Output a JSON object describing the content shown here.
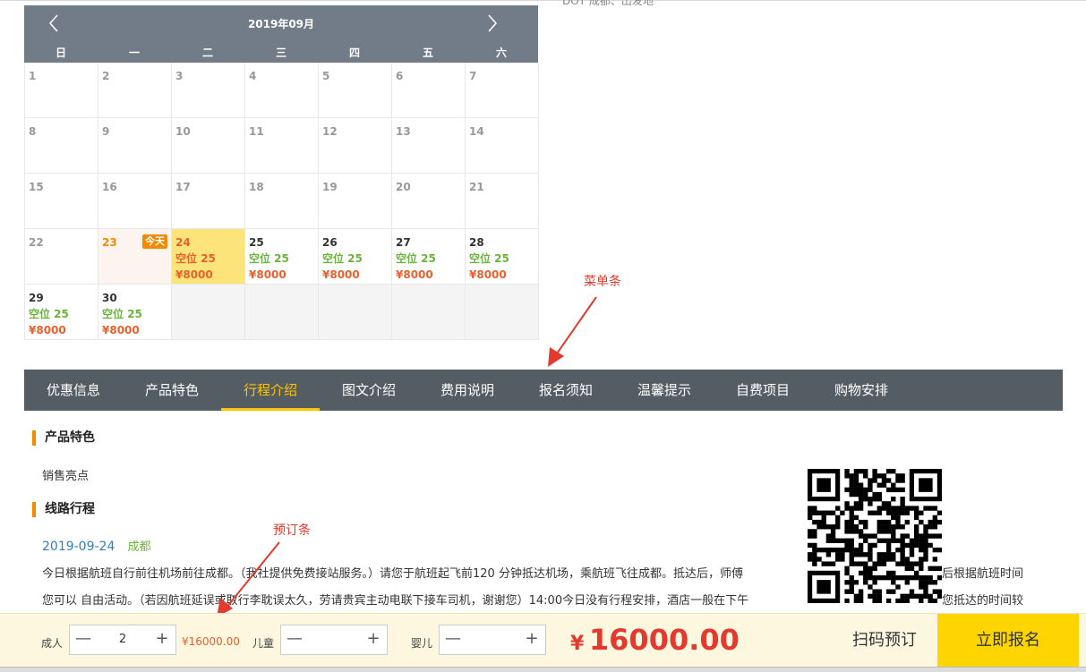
{
  "top_snippet": "DOT 成都、出发地",
  "calendar": {
    "title": "2019年09月",
    "weekdays": [
      "日",
      "一",
      "二",
      "三",
      "四",
      "五",
      "六"
    ],
    "today_badge": "今天",
    "rows": [
      [
        {
          "d": "1"
        },
        {
          "d": "2"
        },
        {
          "d": "3"
        },
        {
          "d": "4"
        },
        {
          "d": "5"
        },
        {
          "d": "6"
        },
        {
          "d": "7"
        }
      ],
      [
        {
          "d": "8"
        },
        {
          "d": "9"
        },
        {
          "d": "10"
        },
        {
          "d": "11"
        },
        {
          "d": "12"
        },
        {
          "d": "13"
        },
        {
          "d": "14"
        }
      ],
      [
        {
          "d": "15"
        },
        {
          "d": "16"
        },
        {
          "d": "17"
        },
        {
          "d": "18"
        },
        {
          "d": "19"
        },
        {
          "d": "20"
        },
        {
          "d": "21"
        }
      ],
      [
        {
          "d": "22"
        },
        {
          "d": "23",
          "today": true
        },
        {
          "d": "24",
          "seats": "空位 25",
          "price": "¥8000",
          "selected": true
        },
        {
          "d": "25",
          "seats": "空位 25",
          "price": "¥8000"
        },
        {
          "d": "26",
          "seats": "空位 25",
          "price": "¥8000"
        },
        {
          "d": "27",
          "seats": "空位 25",
          "price": "¥8000"
        },
        {
          "d": "28",
          "seats": "空位 25",
          "price": "¥8000"
        }
      ],
      [
        {
          "d": "29",
          "seats": "空位 25",
          "price": "¥8000"
        },
        {
          "d": "30",
          "seats": "空位 25",
          "price": "¥8000"
        },
        {},
        {},
        {},
        {},
        {}
      ]
    ]
  },
  "annotations": {
    "menu_label": "菜单条",
    "booking_label": "预订条"
  },
  "menu": {
    "items": [
      "优惠信息",
      "产品特色",
      "行程介绍",
      "图文介绍",
      "费用说明",
      "报名须知",
      "温馨提示",
      "自费项目",
      "购物安排"
    ],
    "active_index": 2
  },
  "content": {
    "feature_title": "产品特色",
    "feature_text": "销售亮点",
    "route_title": "线路行程",
    "day_date": "2019-09-24",
    "day_place": "成都",
    "line1a": "今日根据航班自行前往机场前往成都。（我社提供免费接站服务。）请您于航班起飞前120 分钟抵达机场，乘航班飞往成都。抵达后，师傅",
    "line1b": "后根据航班时间",
    "line2a": "您可以 自由活动。（若因航班延误或取行李耽误太久，劳请贵宾主动电联下接车司机，谢谢您）14:00今日没有行程安排，酒店一般在下午",
    "line2b": "您抵达的时间较"
  },
  "booking": {
    "adult_label": "成人",
    "adult_value": "2",
    "adult_price": "¥16000.00",
    "child_label": "儿童",
    "child_value": "",
    "infant_label": "婴儿",
    "infant_value": "",
    "minus": "—",
    "plus": "+",
    "currency": "¥",
    "total": "16000.00",
    "scan_label": "扫码预订",
    "apply_label": "立即报名"
  }
}
